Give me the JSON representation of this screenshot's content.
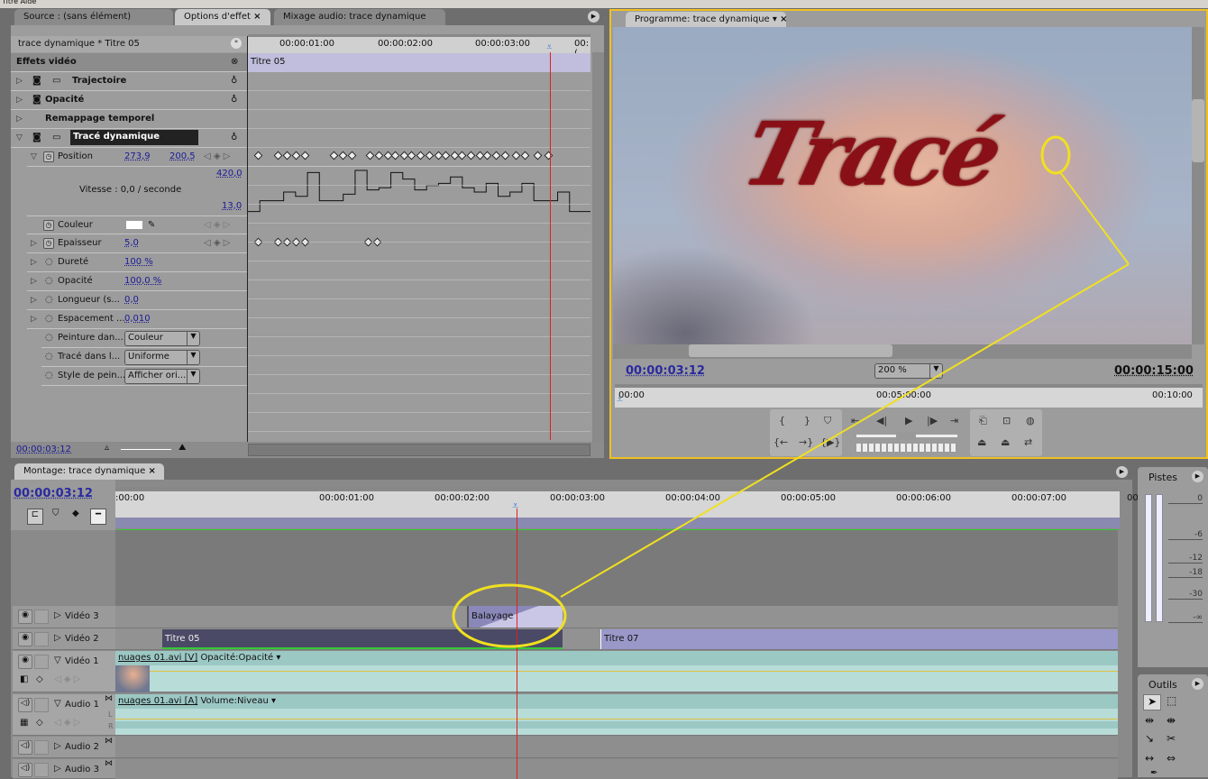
{
  "menu": {
    "text": "Titre  Aide"
  },
  "effect_panel": {
    "tabs": [
      "Source : (sans élément)",
      "Options d'effet",
      "Mixage audio: trace dynamique"
    ],
    "clip_header": "trace dynamique * Titre 05",
    "section": "Effets vidéo",
    "timeline_label": "Titre 05",
    "ruler": [
      "00:00:01:00",
      "00:00:02:00",
      "00:00:03:00",
      "00:("
    ],
    "effects": [
      {
        "name": "Trajectoire"
      },
      {
        "name": "Opacité"
      },
      {
        "name": "Remappage temporel"
      },
      {
        "name": "Tracé dynamique"
      }
    ],
    "position": {
      "label": "Position",
      "x": "273,9",
      "y": "200,5"
    },
    "speed": {
      "label": "Vitesse : 0,0 / seconde",
      "max": "420,0",
      "min": "13,0"
    },
    "params": [
      {
        "label": "Couleur",
        "value": ""
      },
      {
        "label": "Epaisseur",
        "value": "5,0"
      },
      {
        "label": "Dureté",
        "value": "100 %"
      },
      {
        "label": "Opacité",
        "value": "100,0 %"
      },
      {
        "label": "Longueur (s...",
        "value": "0,0"
      },
      {
        "label": "Espacement ...",
        "value": "0,010"
      }
    ],
    "dropdowns": [
      {
        "label": "Peinture dan...",
        "value": "Couleur"
      },
      {
        "label": "Tracé dans l...",
        "value": "Uniforme"
      },
      {
        "label": "Style de pein...",
        "value": "Afficher ori..."
      }
    ],
    "timecode": "00:00:03:12",
    "speed_graph": [
      0.05,
      0.3,
      0.3,
      0.5,
      0.4,
      0.95,
      0.3,
      0.3,
      0.45,
      1.0,
      0.55,
      0.6,
      0.95,
      0.8,
      0.55,
      0.65,
      0.7,
      0.85,
      0.6,
      0.5,
      0.7,
      0.4,
      0.5,
      0.7,
      0.3,
      0.3,
      0.5,
      0.05
    ]
  },
  "program": {
    "tab": "Programme: trace dynamique",
    "overlay_text": "Tracé",
    "timecode": "00:00:03:12",
    "zoom": "200 %",
    "duration": "00:00:15:00",
    "ruler": [
      "00:00",
      "00:05:00:00",
      "00:10:00"
    ]
  },
  "timeline": {
    "tab": "Montage: trace dynamique",
    "timecode": "00:00:03:12",
    "ruler": [
      ":00:00",
      "00:00:01:00",
      "00:00:02:00",
      "00:00:03:00",
      "00:00:04:00",
      "00:00:05:00",
      "00:00:06:00",
      "00:00:07:00",
      "00:00:08:00"
    ],
    "tracks": [
      {
        "name": "Vidéo 3",
        "clips": [
          "Balayage"
        ]
      },
      {
        "name": "Vidéo 2",
        "clips": [
          "Titre 05",
          "Titre 07"
        ]
      },
      {
        "name": "Vidéo 1",
        "clips": [
          "nuages 01.avi [V]"
        ],
        "fx": "Opacité:Opacité"
      },
      {
        "name": "Audio 1",
        "clips": [
          "nuages 01.avi [A]"
        ],
        "fx": "Volume:Niveau"
      },
      {
        "name": "Audio 2",
        "clips": []
      },
      {
        "name": "Audio 3",
        "clips": []
      }
    ],
    "audio_lr": [
      "L",
      "R"
    ]
  },
  "meters": {
    "title": "Pistes",
    "scale": [
      "0",
      "-6",
      "-12",
      "-18",
      "-30",
      "-∞"
    ]
  },
  "tools": {
    "title": "Outils"
  },
  "colors": {
    "highlight": "#f0e020",
    "playhead": "#e02020",
    "title_clip": "#9a98c8",
    "dark_clip": "#4a4a66",
    "video_clip": "#9cc8c4"
  }
}
